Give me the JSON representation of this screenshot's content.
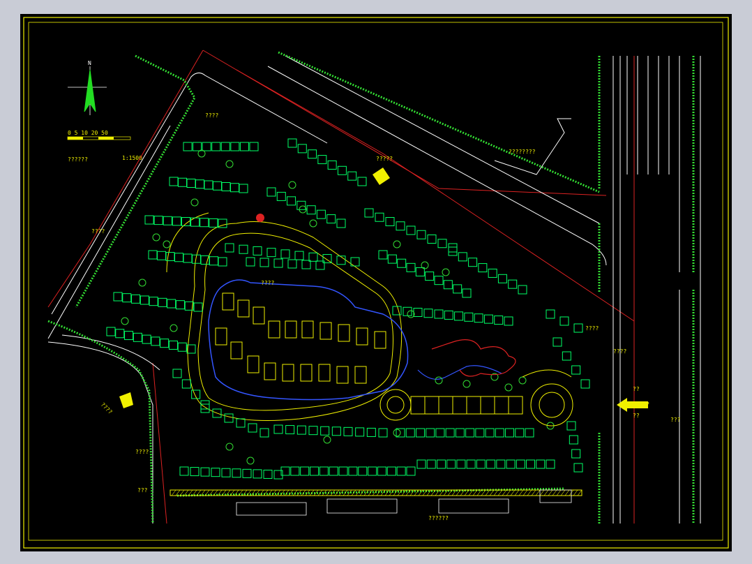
{
  "colors": {
    "background": "#000000",
    "frame": "#f0f000",
    "buildings": "#00ff66",
    "trees": "#33dd33",
    "roads": "#ffffff",
    "red_lines": "#dd2222",
    "water": "#3355ff",
    "page": "#c9ccd6"
  },
  "north_arrow": {
    "letter": "N",
    "icon": "north-arrow-icon"
  },
  "scale_bar": {
    "ticks": "0 5 10 20 50",
    "ratio": "1:1500",
    "title": "??????"
  },
  "labels": {
    "top_left_street": "????",
    "northeast_road": "?????",
    "northeast_building": "????????",
    "west_side": "????",
    "southwest_entrance": "????",
    "south_left_a": "????",
    "south_left_b": "???",
    "south_buildings": "??????",
    "east_a": "????",
    "east_b": "??",
    "east_entrance": "?????",
    "east_c": "??",
    "east_d": "???",
    "east_side": "????",
    "water_feature": "????"
  },
  "entrances": {
    "main": "east-entrance-arrow-icon",
    "north": "north-entrance-arrow-icon",
    "southwest": "southwest-entrance-arrow-icon"
  }
}
